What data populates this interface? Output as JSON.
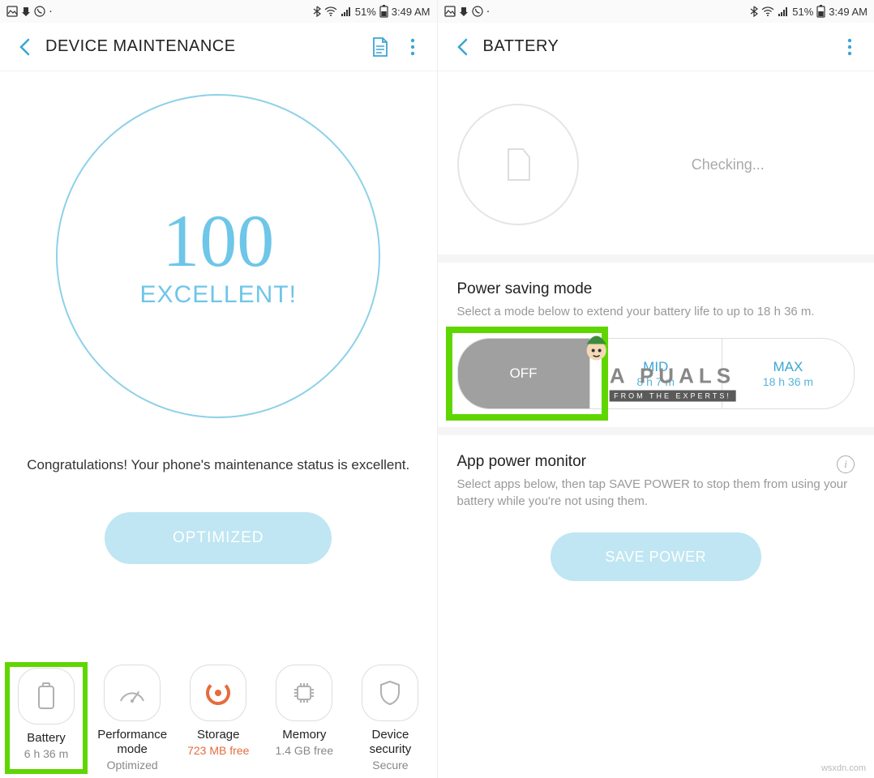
{
  "status": {
    "bt_pct": "51%",
    "time": "3:49 AM"
  },
  "left": {
    "title": "DEVICE MAINTENANCE",
    "score": "100",
    "score_label": "EXCELLENT!",
    "congrat": "Congratulations! Your phone's maintenance status is excellent.",
    "optimized": "OPTIMIZED",
    "items": [
      {
        "label": "Battery",
        "sub": "6 h 36 m",
        "orange": false
      },
      {
        "label": "Performance mode",
        "sub": "Optimized",
        "orange": false
      },
      {
        "label": "Storage",
        "sub": "723 MB free",
        "orange": true
      },
      {
        "label": "Memory",
        "sub": "1.4 GB free",
        "orange": false
      },
      {
        "label": "Device security",
        "sub": "Secure",
        "orange": false
      }
    ]
  },
  "right": {
    "title": "BATTERY",
    "checking": "Checking...",
    "psm_title": "Power saving mode",
    "psm_desc": "Select a mode below to extend your battery life to up to 18 h 36 m.",
    "modes": {
      "off": "OFF",
      "mid": "MID",
      "mid_sub": "8 h 7 m",
      "max": "MAX",
      "max_sub": "18 h 36 m"
    },
    "apm_title": "App power monitor",
    "apm_desc": "Select apps below, then tap SAVE POWER to stop them from using your battery while you're not using them.",
    "save": "SAVE POWER"
  },
  "watermark": {
    "main": "A   PUALS",
    "sub": "FROM THE EXPERTS!"
  },
  "site": "wsxdn.com"
}
